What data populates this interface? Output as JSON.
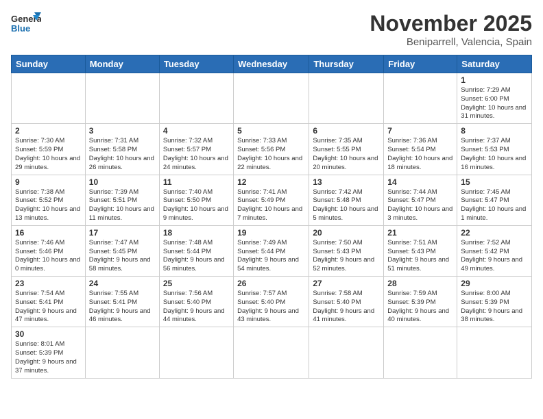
{
  "logo": {
    "line1": "General",
    "line2": "Blue"
  },
  "title": "November 2025",
  "location": "Beniparrell, Valencia, Spain",
  "weekdays": [
    "Sunday",
    "Monday",
    "Tuesday",
    "Wednesday",
    "Thursday",
    "Friday",
    "Saturday"
  ],
  "weeks": [
    [
      {
        "day": "",
        "info": ""
      },
      {
        "day": "",
        "info": ""
      },
      {
        "day": "",
        "info": ""
      },
      {
        "day": "",
        "info": ""
      },
      {
        "day": "",
        "info": ""
      },
      {
        "day": "",
        "info": ""
      },
      {
        "day": "1",
        "info": "Sunrise: 7:29 AM\nSunset: 6:00 PM\nDaylight: 10 hours and 31 minutes."
      }
    ],
    [
      {
        "day": "2",
        "info": "Sunrise: 7:30 AM\nSunset: 5:59 PM\nDaylight: 10 hours and 29 minutes."
      },
      {
        "day": "3",
        "info": "Sunrise: 7:31 AM\nSunset: 5:58 PM\nDaylight: 10 hours and 26 minutes."
      },
      {
        "day": "4",
        "info": "Sunrise: 7:32 AM\nSunset: 5:57 PM\nDaylight: 10 hours and 24 minutes."
      },
      {
        "day": "5",
        "info": "Sunrise: 7:33 AM\nSunset: 5:56 PM\nDaylight: 10 hours and 22 minutes."
      },
      {
        "day": "6",
        "info": "Sunrise: 7:35 AM\nSunset: 5:55 PM\nDaylight: 10 hours and 20 minutes."
      },
      {
        "day": "7",
        "info": "Sunrise: 7:36 AM\nSunset: 5:54 PM\nDaylight: 10 hours and 18 minutes."
      },
      {
        "day": "8",
        "info": "Sunrise: 7:37 AM\nSunset: 5:53 PM\nDaylight: 10 hours and 16 minutes."
      }
    ],
    [
      {
        "day": "9",
        "info": "Sunrise: 7:38 AM\nSunset: 5:52 PM\nDaylight: 10 hours and 13 minutes."
      },
      {
        "day": "10",
        "info": "Sunrise: 7:39 AM\nSunset: 5:51 PM\nDaylight: 10 hours and 11 minutes."
      },
      {
        "day": "11",
        "info": "Sunrise: 7:40 AM\nSunset: 5:50 PM\nDaylight: 10 hours and 9 minutes."
      },
      {
        "day": "12",
        "info": "Sunrise: 7:41 AM\nSunset: 5:49 PM\nDaylight: 10 hours and 7 minutes."
      },
      {
        "day": "13",
        "info": "Sunrise: 7:42 AM\nSunset: 5:48 PM\nDaylight: 10 hours and 5 minutes."
      },
      {
        "day": "14",
        "info": "Sunrise: 7:44 AM\nSunset: 5:47 PM\nDaylight: 10 hours and 3 minutes."
      },
      {
        "day": "15",
        "info": "Sunrise: 7:45 AM\nSunset: 5:47 PM\nDaylight: 10 hours and 1 minute."
      }
    ],
    [
      {
        "day": "16",
        "info": "Sunrise: 7:46 AM\nSunset: 5:46 PM\nDaylight: 10 hours and 0 minutes."
      },
      {
        "day": "17",
        "info": "Sunrise: 7:47 AM\nSunset: 5:45 PM\nDaylight: 9 hours and 58 minutes."
      },
      {
        "day": "18",
        "info": "Sunrise: 7:48 AM\nSunset: 5:44 PM\nDaylight: 9 hours and 56 minutes."
      },
      {
        "day": "19",
        "info": "Sunrise: 7:49 AM\nSunset: 5:44 PM\nDaylight: 9 hours and 54 minutes."
      },
      {
        "day": "20",
        "info": "Sunrise: 7:50 AM\nSunset: 5:43 PM\nDaylight: 9 hours and 52 minutes."
      },
      {
        "day": "21",
        "info": "Sunrise: 7:51 AM\nSunset: 5:43 PM\nDaylight: 9 hours and 51 minutes."
      },
      {
        "day": "22",
        "info": "Sunrise: 7:52 AM\nSunset: 5:42 PM\nDaylight: 9 hours and 49 minutes."
      }
    ],
    [
      {
        "day": "23",
        "info": "Sunrise: 7:54 AM\nSunset: 5:41 PM\nDaylight: 9 hours and 47 minutes."
      },
      {
        "day": "24",
        "info": "Sunrise: 7:55 AM\nSunset: 5:41 PM\nDaylight: 9 hours and 46 minutes."
      },
      {
        "day": "25",
        "info": "Sunrise: 7:56 AM\nSunset: 5:40 PM\nDaylight: 9 hours and 44 minutes."
      },
      {
        "day": "26",
        "info": "Sunrise: 7:57 AM\nSunset: 5:40 PM\nDaylight: 9 hours and 43 minutes."
      },
      {
        "day": "27",
        "info": "Sunrise: 7:58 AM\nSunset: 5:40 PM\nDaylight: 9 hours and 41 minutes."
      },
      {
        "day": "28",
        "info": "Sunrise: 7:59 AM\nSunset: 5:39 PM\nDaylight: 9 hours and 40 minutes."
      },
      {
        "day": "29",
        "info": "Sunrise: 8:00 AM\nSunset: 5:39 PM\nDaylight: 9 hours and 38 minutes."
      }
    ],
    [
      {
        "day": "30",
        "info": "Sunrise: 8:01 AM\nSunset: 5:39 PM\nDaylight: 9 hours and 37 minutes."
      },
      {
        "day": "",
        "info": ""
      },
      {
        "day": "",
        "info": ""
      },
      {
        "day": "",
        "info": ""
      },
      {
        "day": "",
        "info": ""
      },
      {
        "day": "",
        "info": ""
      },
      {
        "day": "",
        "info": ""
      }
    ]
  ]
}
